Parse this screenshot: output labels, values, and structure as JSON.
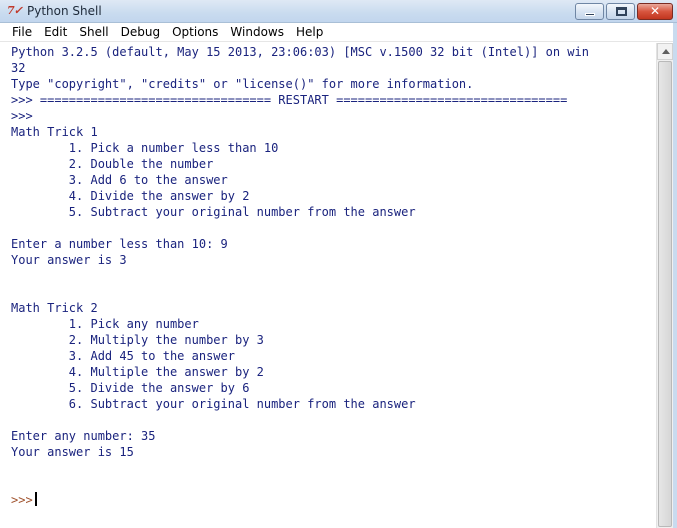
{
  "window": {
    "title": "Python Shell",
    "icon": "python-idle-icon",
    "close_glyph": "✕"
  },
  "menubar": {
    "items": [
      "File",
      "Edit",
      "Shell",
      "Debug",
      "Options",
      "Windows",
      "Help"
    ]
  },
  "shell": {
    "lines": [
      {
        "text": "Python 3.2.5 (default, May 15 2013, 23:06:03) [MSC v.1500 32 bit (Intel)] on win",
        "kind": "stdout"
      },
      {
        "text": "32",
        "kind": "stdout"
      },
      {
        "text": "Type \"copyright\", \"credits\" or \"license()\" for more information.",
        "kind": "stdout"
      },
      {
        "text": ">>> ================================ RESTART ================================",
        "kind": "stdout"
      },
      {
        "text": ">>>",
        "kind": "stdout"
      },
      {
        "text": "Math Trick 1",
        "kind": "stdout"
      },
      {
        "text": "        1. Pick a number less than 10",
        "kind": "stdout"
      },
      {
        "text": "        2. Double the number",
        "kind": "stdout"
      },
      {
        "text": "        3. Add 6 to the answer",
        "kind": "stdout"
      },
      {
        "text": "        4. Divide the answer by 2",
        "kind": "stdout"
      },
      {
        "text": "        5. Subtract your original number from the answer",
        "kind": "stdout"
      },
      {
        "text": "",
        "kind": "stdout"
      },
      {
        "text": "Enter a number less than 10: 9",
        "kind": "stdout"
      },
      {
        "text": "Your answer is 3",
        "kind": "stdout"
      },
      {
        "text": "",
        "kind": "stdout"
      },
      {
        "text": "",
        "kind": "stdout"
      },
      {
        "text": "Math Trick 2",
        "kind": "stdout"
      },
      {
        "text": "        1. Pick any number",
        "kind": "stdout"
      },
      {
        "text": "        2. Multiply the number by 3",
        "kind": "stdout"
      },
      {
        "text": "        3. Add 45 to the answer",
        "kind": "stdout"
      },
      {
        "text": "        4. Multiple the answer by 2",
        "kind": "stdout"
      },
      {
        "text": "        5. Divide the answer by 6",
        "kind": "stdout"
      },
      {
        "text": "        6. Subtract your original number from the answer",
        "kind": "stdout"
      },
      {
        "text": "",
        "kind": "stdout"
      },
      {
        "text": "Enter any number: 35",
        "kind": "stdout"
      },
      {
        "text": "Your answer is 15",
        "kind": "stdout"
      },
      {
        "text": "",
        "kind": "stdout"
      },
      {
        "text": "",
        "kind": "stdout"
      },
      {
        "text": ">>>",
        "kind": "prompt"
      }
    ],
    "colors": {
      "stdout": "#1a237e",
      "prompt": "#a0522d"
    }
  }
}
